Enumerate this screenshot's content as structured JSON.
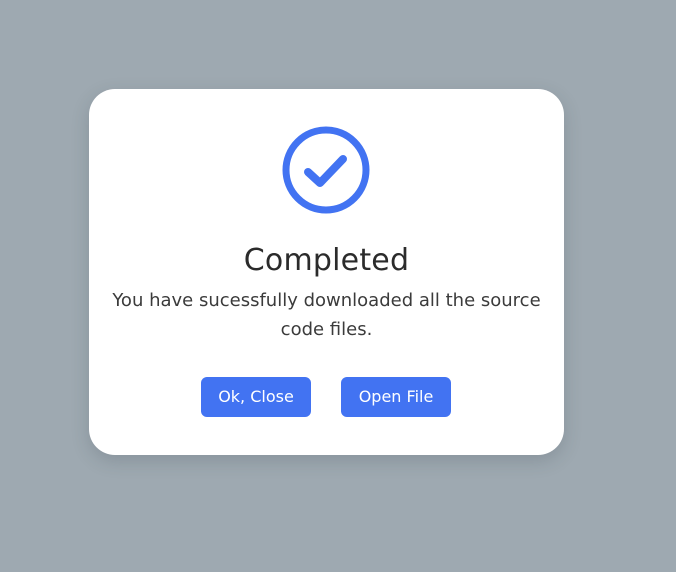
{
  "dialog": {
    "title": "Completed",
    "message": "You have sucessfully downloaded all the source code files.",
    "icon": "check-circle-icon",
    "buttons": {
      "close_label": "Ok, Close",
      "open_label": "Open File"
    }
  },
  "colors": {
    "accent": "#4273f2",
    "backdrop": "#9ea9b1",
    "dialog_bg": "#ffffff",
    "title_text": "#2b2b2b"
  }
}
